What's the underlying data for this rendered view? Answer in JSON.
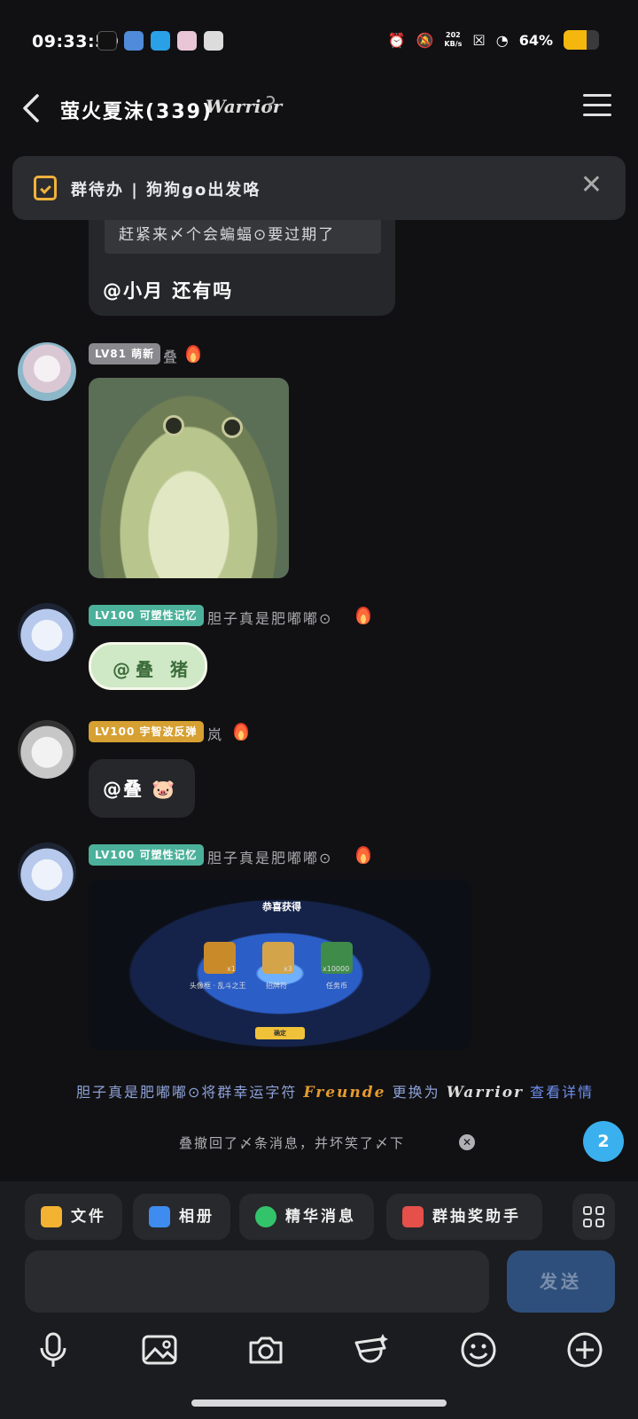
{
  "status": {
    "time": "09:33:59",
    "net_speed_value": "202",
    "net_speed_unit": "KB/s",
    "battery": "64%",
    "battery_level": 0.64
  },
  "header": {
    "title": "萤火夏沫(339)",
    "title_badge": "Warrior",
    "ear_icon": "ʔ"
  },
  "todo": {
    "text": "群待办 | 狗狗go出发咯",
    "close": "✕"
  },
  "messages": {
    "first": {
      "quote": "赶紧来〆个会蝙蝠⊙要过期了",
      "text": "@小月 还有吗"
    },
    "second": {
      "level": "LV81 萌新",
      "sender": "叠"
    },
    "third": {
      "level": "LV100 可塑性记忆",
      "sender": "胆子真是肥嘟嘟⊙",
      "sticker": "@叠 猪"
    },
    "fourth": {
      "level": "LV100 宇智波反弹",
      "sender": "岚",
      "text": "@叠 🐷"
    },
    "fifth": {
      "level": "LV100 可塑性记忆",
      "sender": "胆子真是肥嘟嘟⊙",
      "game": {
        "title": "恭喜获得",
        "rewards": [
          {
            "label": "头像框 · 乱斗之王",
            "count": "x1"
          },
          {
            "label": "招牌符",
            "count": "x3"
          },
          {
            "label": "任务币",
            "count": "x10000"
          }
        ],
        "confirm": "确定"
      }
    }
  },
  "system": {
    "change_prefix": "胆子真是肥嘟嘟⊙将群幸运字符",
    "old_badge": "Freunde",
    "change_middle": "更换为",
    "new_badge": "Warrior",
    "detail_link": "查看详情",
    "recall": "叠撤回了〆条消息，并坏笑了〆下",
    "recall_close": "✕"
  },
  "unread_count": "2",
  "quick_actions": [
    {
      "label": "文件"
    },
    {
      "label": "相册"
    },
    {
      "label": "精华消息"
    },
    {
      "label": "群抽奖助手"
    }
  ],
  "composer": {
    "placeholder": "",
    "send": "发送"
  },
  "colors": {
    "accent": "#3bb0ee",
    "send_disabled": "#2e4f7b",
    "level_teal": "#4cb19b",
    "level_gold": "#d6a032"
  }
}
